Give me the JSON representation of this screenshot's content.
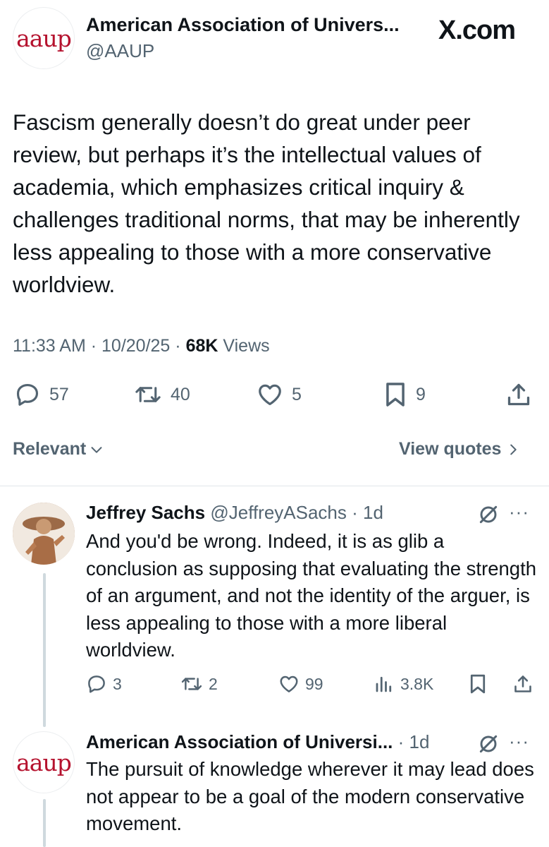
{
  "header": {
    "name": "American Association of Univers...",
    "handle": "@AAUP",
    "site": "X.com",
    "avatar_text": "aaup"
  },
  "tweet": {
    "text": "Fascism generally doesn’t do great under peer review, but perhaps it’s the intellectual values of academia, which emphasizes critical inquiry & challenges traditional norms, that may be inherently less appealing to those with a more conservative worldview.",
    "time": "11:33 AM",
    "date": "10/20/25",
    "views_count": "68K",
    "views_label": "Views",
    "replies": "57",
    "reposts": "40",
    "likes": "5",
    "bookmarks": "9"
  },
  "bar": {
    "relevant_label": "Relevant",
    "view_quotes_label": "View quotes"
  },
  "replies": [
    {
      "name": "Jeffrey Sachs",
      "handle": "@JeffreyASachs",
      "age": "1d",
      "text": "And you'd be wrong. Indeed, it is as glib a conclusion as supposing that evaluating the strength of an argument, and not the identity of the arguer, is less appealing to those with a more liberal worldview.",
      "replies": "3",
      "reposts": "2",
      "likes": "99",
      "views": "3.8K"
    },
    {
      "name": "American Association of Universi...",
      "age": "1d",
      "avatar_text": "aaup",
      "text": "The pursuit of knowledge wherever it may lead does not appear to be a goal of the modern conservative movement."
    }
  ],
  "colors": {
    "text": "#0f1419",
    "muted": "#536471",
    "aaup_red": "#b5122e",
    "divider": "#e1e6ea"
  },
  "icons": [
    "reply-icon",
    "repost-icon",
    "like-icon",
    "bookmark-icon",
    "share-icon",
    "views-icon",
    "grok-icon",
    "more-icon",
    "chevron-down-icon",
    "chevron-right-icon"
  ]
}
